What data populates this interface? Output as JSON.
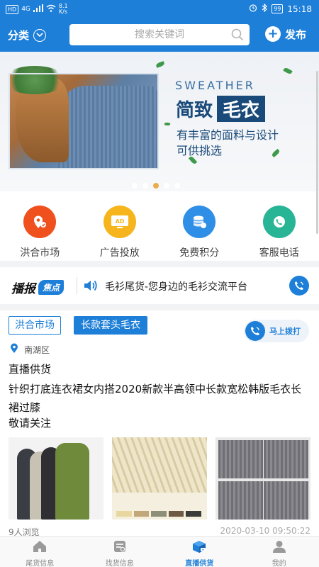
{
  "status_bar": {
    "network": "HD",
    "signal": "4G",
    "speed_value": "8.1",
    "speed_unit": "K/s",
    "battery": "99",
    "time": "15:18",
    "icons": [
      "alarm-icon",
      "bluetooth-icon",
      "battery-icon",
      "wifi-icon",
      "signal-icon"
    ]
  },
  "header": {
    "category_label": "分类",
    "search_placeholder": "搜索关键词",
    "publish_label": "发布"
  },
  "banner": {
    "en_title": "SWEATHER",
    "cn_title_plain": "简致",
    "cn_title_boxed": "毛衣",
    "subtitle_line1": "有丰富的面料与设计",
    "subtitle_line2": "可供挑选",
    "slide_count": 5,
    "active_slide": 3
  },
  "quick_menu": [
    {
      "label": "洪合市场",
      "icon": "map-pin-icon",
      "color": "#f0501e"
    },
    {
      "label": "广告投放",
      "icon": "ad-icon",
      "color": "#f6b51d"
    },
    {
      "label": "免费积分",
      "icon": "coins-icon",
      "color": "#2f8ee6"
    },
    {
      "label": "客服电话",
      "icon": "phone-icon",
      "color": "#27b596"
    }
  ],
  "ticker": {
    "brand_main": "播报",
    "brand_badge": "焦点",
    "text": "毛衫尾货-您身边的毛衫交流平台"
  },
  "post": {
    "tag_market": "洪合市场",
    "tag_category": "长款套头毛衣",
    "call_label": "马上拨打",
    "location": "南湖区",
    "title": "直播供货",
    "body": "针织打底连衣裙女内搭2020新款半高领中长款宽松韩版毛衣长裙过膝",
    "sign_off": "敬请关注",
    "meta_left": "9人浏览",
    "meta_right": "2020-03-10 09:50:22"
  },
  "tabs": [
    {
      "label": "尾货信息",
      "icon": "home-icon",
      "active": false
    },
    {
      "label": "找货信息",
      "icon": "list-icon",
      "active": false
    },
    {
      "label": "直播供货",
      "icon": "live-box-icon",
      "active": true
    },
    {
      "label": "我的",
      "icon": "user-icon",
      "active": false
    }
  ],
  "colors": {
    "primary": "#1d7fd8",
    "banner_text": "#1a4a79",
    "active_dot": "#e9a23b"
  }
}
